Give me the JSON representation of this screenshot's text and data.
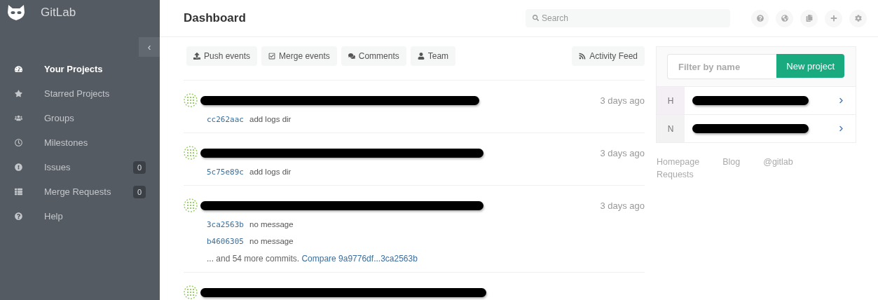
{
  "sidebar": {
    "brand": "GitLab",
    "collapse_label": "‹",
    "items": [
      {
        "label": "Your Projects",
        "selected": true
      },
      {
        "label": "Starred Projects",
        "selected": false
      },
      {
        "label": "Groups",
        "selected": false
      },
      {
        "label": "Milestones",
        "selected": false
      },
      {
        "label": "Issues",
        "selected": false,
        "count": "0"
      },
      {
        "label": "Merge Requests",
        "selected": false,
        "count": "0"
      },
      {
        "label": "Help",
        "selected": false
      }
    ]
  },
  "header": {
    "title": "Dashboard",
    "search": {
      "placeholder": "Search"
    }
  },
  "filters": [
    {
      "label": "Push events",
      "selected": false
    },
    {
      "label": "Merge events",
      "selected": false
    },
    {
      "label": "Comments",
      "selected": false
    },
    {
      "label": "Team",
      "selected": false
    }
  ],
  "activity_feed": "Activity Feed",
  "events": [
    {
      "cut_off": false,
      "time": "3 days ago",
      "commits": [
        {
          "sha": "cc262aac",
          "message": "add logs dir"
        }
      ]
    },
    {
      "cut_off": false,
      "time": "3 days ago",
      "commits": [
        {
          "sha": "5c75e89c",
          "message": "add logs dir"
        }
      ]
    },
    {
      "cut_off": false,
      "time": "3 days ago",
      "commits": [
        {
          "sha": "3ca2563b",
          "message": "no message"
        },
        {
          "sha": "b4606305",
          "message": "no message"
        }
      ],
      "more": "... and 54 more commits.",
      "compare": "Compare 9a9776df...3ca2563b"
    },
    {
      "cut_off": true
    }
  ],
  "projects_panel": {
    "filter_placeholder": "Filter by name",
    "new_button": "New project",
    "projects": [
      {
        "initial": "H"
      },
      {
        "initial": "N"
      }
    ]
  },
  "footer_links": [
    "Homepage",
    "Blog",
    "@gitlab",
    "Requests"
  ]
}
